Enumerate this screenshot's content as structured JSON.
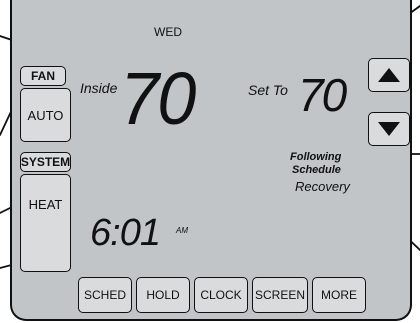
{
  "day": "WED",
  "inside_label": "Inside",
  "inside_temp": "70",
  "set_to_label": "Set To",
  "set_temp": "70",
  "fan": {
    "label": "FAN",
    "mode": "AUTO"
  },
  "system": {
    "label": "SYSTEM",
    "mode": "HEAT"
  },
  "status": {
    "line1": "Following",
    "line2": "Schedule",
    "line3": "Recovery"
  },
  "time": "6:01",
  "am_pm": "AM",
  "bottom_buttons": [
    "SCHED",
    "HOLD",
    "CLOCK",
    "SCREEN",
    "MORE"
  ],
  "arrows": {
    "up": "up-arrow-icon",
    "down": "down-arrow-icon"
  },
  "colors": {
    "screen": "#c2c5c8",
    "button": "#d9dbdd",
    "ink": "#111111"
  }
}
